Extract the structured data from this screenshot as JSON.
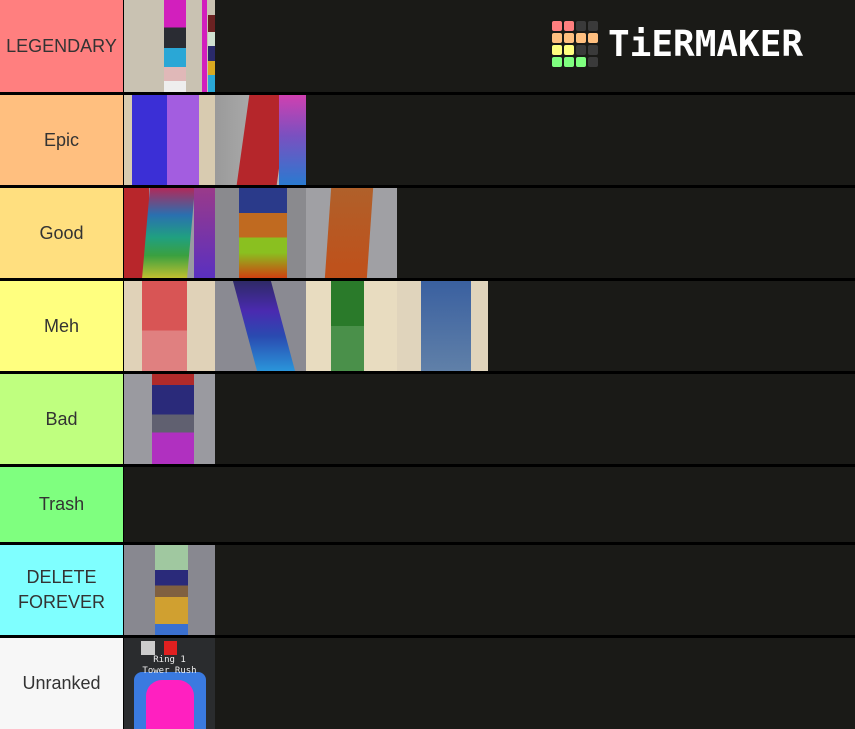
{
  "brand": {
    "name": "TiERMAKER",
    "grid_colors": [
      "#ff7f7f",
      "#ff7f7f",
      "#3a3a3a",
      "#3a3a3a",
      "#ffbf7f",
      "#ffbf7f",
      "#ffbf7f",
      "#ffbf7f",
      "#ffff7f",
      "#ffff7f",
      "#3a3a3a",
      "#3a3a3a",
      "#7fff7f",
      "#7fff7f",
      "#7fff7f",
      "#3a3a3a"
    ]
  },
  "tiers": [
    {
      "label": "LEGENDARY",
      "color": "#ff7f7f",
      "items": [
        "tower-pink-black-blue"
      ]
    },
    {
      "label": "Epic",
      "color": "#ffbf7f",
      "items": [
        "tower-blue-purple",
        "tower-red-rainbow"
      ]
    },
    {
      "label": "Good",
      "color": "#ffdf7f",
      "items": [
        "tower-rainbow-angled",
        "tower-navy-orange-green",
        "tower-orange-gray"
      ]
    },
    {
      "label": "Meh",
      "color": "#ffff7f",
      "items": [
        "tower-red-pink",
        "tower-purple-cyan-angled",
        "tower-green",
        "tower-steel-blue"
      ]
    },
    {
      "label": "Bad",
      "color": "#bfff7f",
      "items": [
        "tower-red-navy-magenta"
      ]
    },
    {
      "label": "Trash",
      "color": "#7fff7f",
      "items": []
    },
    {
      "label": "DELETE FOREVER",
      "color": "#7fffff",
      "items": [
        "tower-mint-navy-gold"
      ]
    },
    {
      "label": "Unranked",
      "color": "#f7f7f7",
      "items": [
        "ring-1-tower-rush"
      ]
    }
  ],
  "unranked_item_text": {
    "line1": "Ring 1",
    "line2": "Tower Rush"
  }
}
